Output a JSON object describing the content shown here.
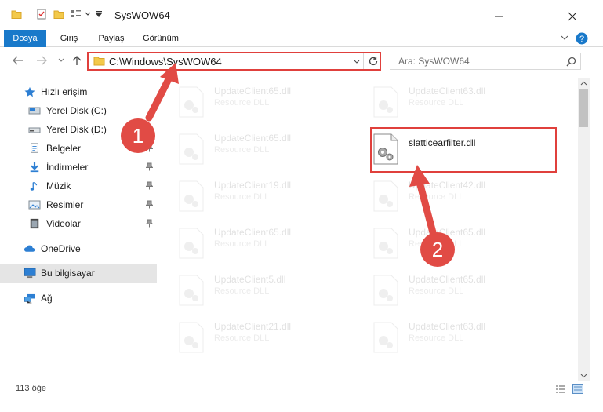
{
  "window": {
    "title": "SysWOW64",
    "minimize_icon": "minimize-icon",
    "maximize_icon": "maximize-icon",
    "close_icon": "close-icon"
  },
  "ribbon": {
    "tabs": [
      {
        "label": "Dosya",
        "active": true
      },
      {
        "label": "Giriş",
        "active": false
      },
      {
        "label": "Paylaş",
        "active": false
      },
      {
        "label": "Görünüm",
        "active": false
      }
    ]
  },
  "address": {
    "path": "C:\\Windows\\SysWOW64"
  },
  "search": {
    "placeholder": "Ara: SysWOW64"
  },
  "sidebar": {
    "items": [
      {
        "label": "Hızlı erişim",
        "icon": "star-icon"
      },
      {
        "label": "Yerel Disk (C:)",
        "icon": "drive-icon"
      },
      {
        "label": "Yerel Disk (D:)",
        "icon": "drive-icon"
      },
      {
        "label": "Belgeler",
        "icon": "documents-icon"
      },
      {
        "label": "İndirmeler",
        "icon": "download-icon"
      },
      {
        "label": "Müzik",
        "icon": "music-icon"
      },
      {
        "label": "Resimler",
        "icon": "pictures-icon"
      },
      {
        "label": "Videolar",
        "icon": "video-icon"
      },
      {
        "label": "OneDrive",
        "icon": "cloud-icon"
      },
      {
        "label": "Bu bilgisayar",
        "icon": "computer-icon",
        "selected": true
      },
      {
        "label": "Ağ",
        "icon": "network-icon"
      }
    ]
  },
  "files": {
    "left": [
      {
        "name": "UpdateClient65.dll",
        "type": "Resource DLL"
      },
      {
        "name": "UpdateClient65.dll",
        "type": "Resource DLL"
      },
      {
        "name": "UpdateClient19.dll",
        "type": "Resource DLL"
      },
      {
        "name": "UpdateClient65.dll",
        "type": "Resource DLL"
      },
      {
        "name": "UpdateClient5.dll",
        "type": "Resource DLL"
      },
      {
        "name": "UpdateClient21.dll",
        "type": "Resource DLL"
      }
    ],
    "right": [
      {
        "name": "UpdateClient63.dll",
        "type": "Resource DLL"
      },
      {
        "name": "slatticearfilter.dll",
        "type": ""
      },
      {
        "name": "UpdateClient42.dll",
        "type": "Resource DLL"
      },
      {
        "name": "UpdateClient65.dll",
        "type": "Resource DLL"
      },
      {
        "name": "UpdateClient65.dll",
        "type": "Resource DLL"
      },
      {
        "name": "UpdateClient63.dll",
        "type": "Resource DLL"
      }
    ]
  },
  "status": {
    "count": "113 öğe"
  },
  "callouts": {
    "one": "1",
    "two": "2"
  },
  "colors": {
    "accent": "#1979ca",
    "annotation": "#e0403c"
  }
}
